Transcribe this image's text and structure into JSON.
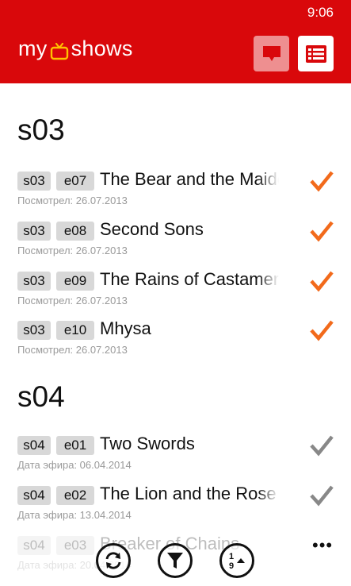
{
  "status_bar": {
    "time": "9:06"
  },
  "header": {
    "logo_left": "my",
    "logo_right": "shows",
    "accent": "#d9080b",
    "check_watched": "#f26a1b",
    "check_unwatched": "#888888"
  },
  "seasons": [
    {
      "title": "s03",
      "episodes": [
        {
          "season": "s03",
          "episode": "e07",
          "title": "The Bear and the Maiden Fair",
          "subtitle": "Посмотрел: 26.07.2013",
          "watched": true
        },
        {
          "season": "s03",
          "episode": "e08",
          "title": "Second Sons",
          "subtitle": "Посмотрел: 26.07.2013",
          "watched": true
        },
        {
          "season": "s03",
          "episode": "e09",
          "title": "The Rains of Castamere",
          "subtitle": "Посмотрел: 26.07.2013",
          "watched": true
        },
        {
          "season": "s03",
          "episode": "e10",
          "title": "Mhysa",
          "subtitle": "Посмотрел: 26.07.2013",
          "watched": true
        }
      ]
    },
    {
      "title": "s04",
      "episodes": [
        {
          "season": "s04",
          "episode": "e01",
          "title": "Two Swords",
          "subtitle": "Дата эфира: 06.04.2014",
          "watched": false
        },
        {
          "season": "s04",
          "episode": "e02",
          "title": "The Lion and the Rose",
          "subtitle": "Дата эфира: 13.04.2014",
          "watched": false
        },
        {
          "season": "s04",
          "episode": "e03",
          "title": "Breaker of Chains",
          "subtitle": "Дата эфира: 20.04.2014",
          "watched": false
        }
      ]
    }
  ],
  "app_bar": {
    "buttons": [
      {
        "icon": "refresh-icon"
      },
      {
        "icon": "filter-icon"
      },
      {
        "icon": "sort-icon"
      }
    ],
    "more": "•••"
  }
}
